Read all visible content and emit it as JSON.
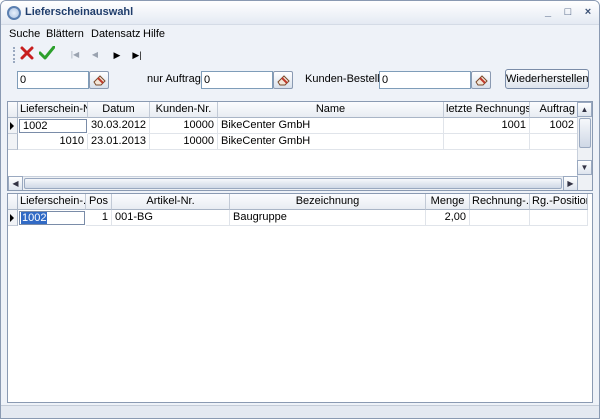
{
  "window": {
    "title": "Lieferscheinauswahl",
    "minimize_glyph": "_",
    "maximize_glyph": "□",
    "close_glyph": "×"
  },
  "menu": {
    "items": [
      "Suche",
      "Blättern",
      "Datensatz",
      "Hilfe"
    ]
  },
  "toolbar": {
    "cancel_icon": "red-x-icon",
    "accept_icon": "green-check-icon",
    "first_glyph": "|◀",
    "prev_glyph": "◀",
    "next_glyph": "▶",
    "last_glyph": "▶|"
  },
  "filters": {
    "field1_value": "0",
    "nur_auftrag_label": "nur Auftrag:",
    "nur_auftrag_value": "0",
    "kunden_bestellnr_label": "Kunden-Bestellnr.:",
    "kunden_bestellnr_value": "0",
    "restore_label": "Wiederherstellen"
  },
  "top_grid": {
    "headers": [
      "Lieferschein-Nr.",
      "Datum",
      "Kunden-Nr.",
      "Name",
      "letzte Rechnungsnr.",
      "Auftrag"
    ],
    "rows": [
      [
        "1002",
        "30.03.2012",
        "10000",
        "BikeCenter GmbH",
        "1001",
        "1002"
      ],
      [
        "1010",
        "23.01.2013",
        "10000",
        "BikeCenter GmbH",
        "",
        ""
      ]
    ]
  },
  "bottom_grid": {
    "headers": [
      "Lieferschein-...",
      "Pos",
      "Artikel-Nr.",
      "Bezeichnung",
      "Menge",
      "Rechnung-...",
      "Rg.-Position"
    ],
    "rows": [
      [
        "1002",
        "1",
        "001-BG",
        "Baugruppe",
        "2,00",
        "",
        ""
      ]
    ]
  },
  "colors": {
    "accent": "#316ac5",
    "title": "#1f3d6b",
    "window_bg": "#eef2f8"
  }
}
